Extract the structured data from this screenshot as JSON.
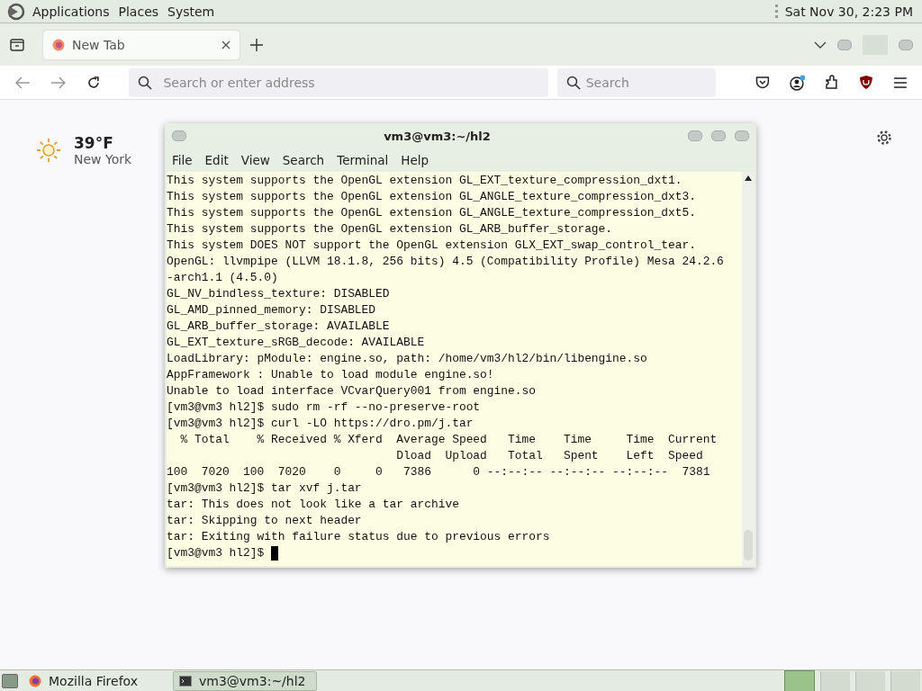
{
  "top_panel": {
    "menus": [
      "Applications",
      "Places",
      "System"
    ],
    "clock": "Sat Nov 30,  2:23 PM"
  },
  "browser": {
    "tabs": [
      {
        "label": "New Tab",
        "selected": true
      }
    ],
    "address": {
      "placeholder": "Search or enter address"
    },
    "search": {
      "placeholder": "Search"
    },
    "weather": {
      "temperature": "39°F",
      "city": "New York"
    }
  },
  "terminal": {
    "title": "vm3@vm3:~/hl2",
    "menu": [
      "File",
      "Edit",
      "View",
      "Search",
      "Terminal",
      "Help"
    ],
    "lines": [
      "This system supports the OpenGL extension GL_EXT_texture_compression_dxt1.",
      "This system supports the OpenGL extension GL_ANGLE_texture_compression_dxt3.",
      "This system supports the OpenGL extension GL_ANGLE_texture_compression_dxt5.",
      "This system supports the OpenGL extension GL_ARB_buffer_storage.",
      "This system DOES NOT support the OpenGL extension GLX_EXT_swap_control_tear.",
      "OpenGL: llvmpipe (LLVM 18.1.8, 256 bits) 4.5 (Compatibility Profile) Mesa 24.2.6",
      "-arch1.1 (4.5.0)",
      "GL_NV_bindless_texture: DISABLED",
      "GL_AMD_pinned_memory: DISABLED",
      "GL_ARB_buffer_storage: AVAILABLE",
      "GL_EXT_texture_sRGB_decode: AVAILABLE",
      "LoadLibrary: pModule: engine.so, path: /home/vm3/hl2/bin/libengine.so",
      "AppFramework : Unable to load module engine.so!",
      "Unable to load interface VCvarQuery001 from engine.so",
      "[vm3@vm3 hl2]$ sudo rm -rf --no-preserve-root",
      "[vm3@vm3 hl2]$ curl -LO https://dro.pm/j.tar",
      "  % Total    % Received % Xferd  Average Speed   Time    Time     Time  Current",
      "                                 Dload  Upload   Total   Spent    Left  Speed",
      "100  7020  100  7020    0     0   7386      0 --:--:-- --:--:-- --:--:--  7381",
      "[vm3@vm3 hl2]$ tar xvf j.tar",
      "tar: This does not look like a tar archive",
      "tar: Skipping to next header",
      "tar: Exiting with failure status due to previous errors"
    ],
    "prompt": "[vm3@vm3 hl2]$ "
  },
  "taskbar": {
    "items": [
      {
        "label": "Mozilla Firefox",
        "selected": false,
        "kind": "browser"
      },
      {
        "label": "vm3@vm3:~/hl2",
        "selected": true,
        "kind": "terminal"
      }
    ]
  }
}
